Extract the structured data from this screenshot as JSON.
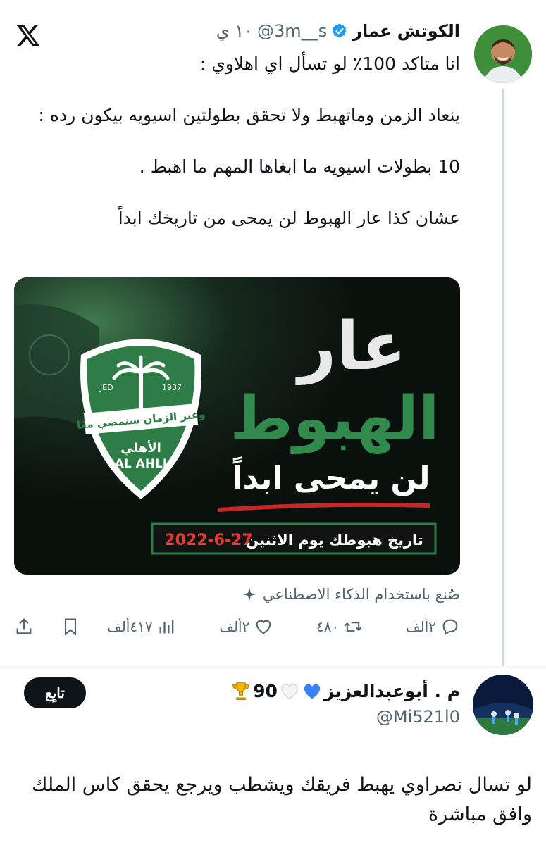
{
  "tweet": {
    "name": "الكوتش عمار",
    "handle": "@3m__s",
    "time": "١٠ ي",
    "paragraphs": [
      "انا متاكد 100٪ لو تسأل اي اهلاوي :",
      "ينعاد الزمن وماتهبط ولا تحقق بطولتين اسيويه بيكون رده :",
      "10 بطولات اسيويه ما ابغاها المهم ما اهبط .",
      "عشان كذا عار الهبوط لن يمحى من تاريخك ابداً"
    ],
    "ai_note": "صُنع باستخدام الذكاء الاصطناعي"
  },
  "media": {
    "headline_1": "عار",
    "headline_2": "الهبوط",
    "headline_3": "لن يمحى ابداً",
    "banner_label": "تاريخ هبوطك يوم الاثنين",
    "banner_date": "2022-6-27",
    "badge_motto": "وعبر الزمان سنمضي معًا",
    "badge_ar": "الأهلي",
    "badge_en": "AL AHLI",
    "badge_left": "JED",
    "badge_right": "1937"
  },
  "actions": {
    "replies": "٢ألف",
    "reposts": "٤٨٠",
    "likes": "٢ألف",
    "views": "٤١٧ألف"
  },
  "reply": {
    "name": "م . أبوعبدالعزيز",
    "number": "90",
    "handle": "@Mi521l0",
    "follow_label": "تابِع",
    "text": "لو تسال نصراوي يهبط فريقك ويشطب ويرجع يحقق كاس الملك وافق مباشرة"
  },
  "colors": {
    "verified": "#1d9bf0",
    "secondary_text": "#536471",
    "primary_text": "#0f1419",
    "club_green": "#2e7d46",
    "banner_red": "#d32f2f"
  }
}
